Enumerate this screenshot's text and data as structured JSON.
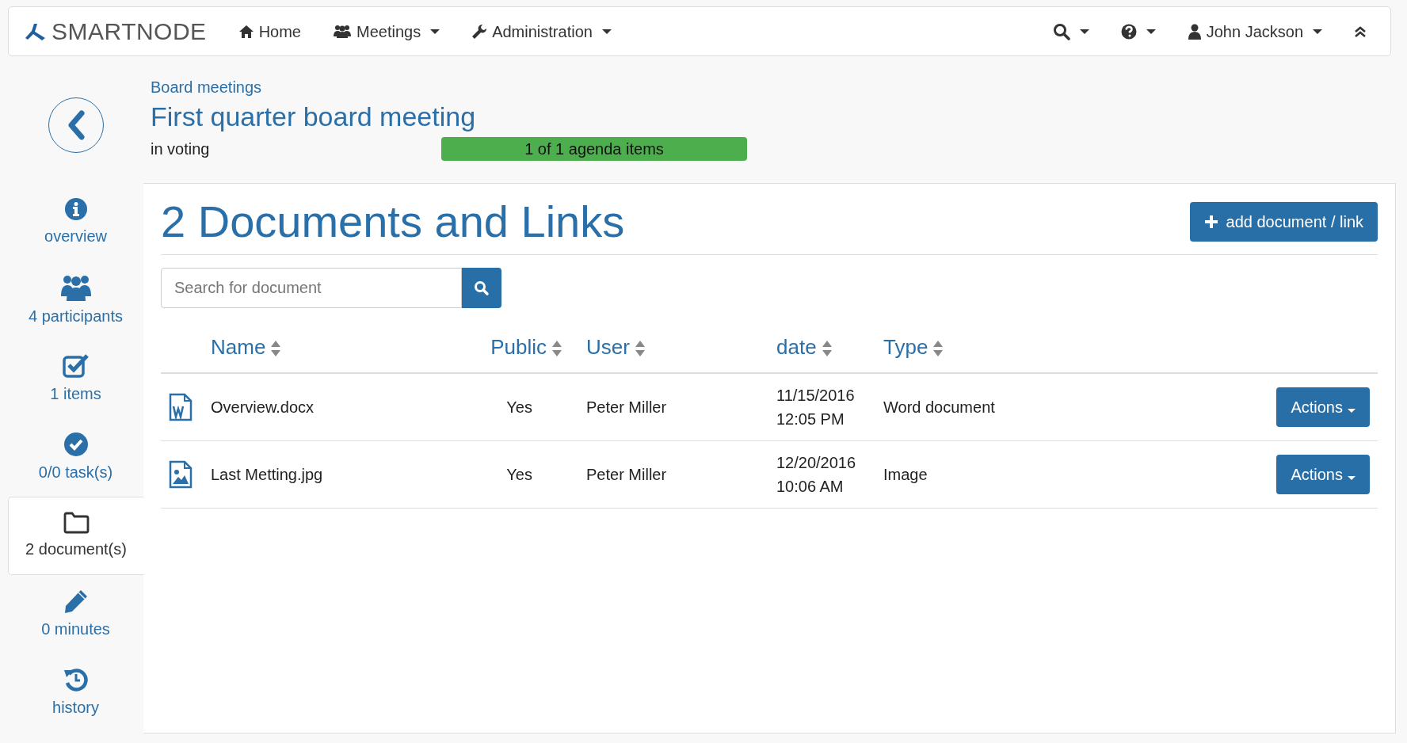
{
  "navbar": {
    "brand": "SMARTNODE",
    "items": [
      {
        "label": "Home",
        "dropdown": false
      },
      {
        "label": "Meetings",
        "dropdown": true
      },
      {
        "label": "Administration",
        "dropdown": true
      }
    ],
    "user": "John Jackson"
  },
  "sidebar": {
    "items": [
      {
        "label": "overview",
        "selected": false
      },
      {
        "label": "4 participants",
        "selected": false
      },
      {
        "label": "1 items",
        "selected": false
      },
      {
        "label": "0/0 task(s)",
        "selected": false
      },
      {
        "label": "2 document(s)",
        "selected": true
      },
      {
        "label": "0 minutes",
        "selected": false
      },
      {
        "label": "history",
        "selected": false
      }
    ]
  },
  "header": {
    "breadcrumb": "Board meetings",
    "title": "First quarter board meeting",
    "status": "in voting",
    "progress": {
      "label": "1 of 1 agenda items",
      "level": 1
    }
  },
  "panel": {
    "title": "2 Documents and Links",
    "add_button": "add document / link",
    "search": {
      "placeholder": "Search for document"
    },
    "table": {
      "columns": [
        "Name",
        "Public",
        "User",
        "date",
        "Type"
      ],
      "rows": [
        {
          "kind": "word",
          "name": "Overview.docx",
          "public": "Yes",
          "user": "Peter Miller",
          "date": "11/15/2016",
          "time": "12:05 PM",
          "type": "Word document",
          "action": "Actions"
        },
        {
          "kind": "image",
          "name": "Last Metting.jpg",
          "public": "Yes",
          "user": "Peter Miller",
          "date": "12/20/2016",
          "time": "10:06 AM",
          "type": "Image",
          "action": "Actions"
        }
      ]
    }
  }
}
